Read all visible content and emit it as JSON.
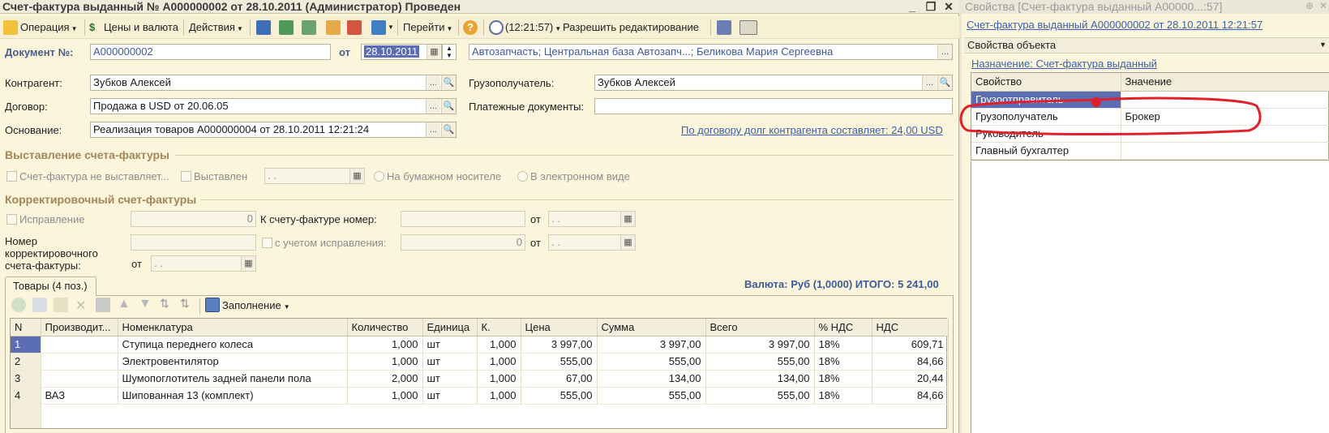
{
  "window": {
    "title": "Счет-фактура выданный № А000000002 от 28.10.2011 (Администратор) Проведен",
    "controls": [
      "_",
      "❐",
      "✕"
    ]
  },
  "toolbar": {
    "operation": "Операция",
    "prices": "Цены и валюта",
    "actions": "Действия",
    "goto": "Перейти",
    "time": "(12:21:57)",
    "allow_edit": "Разрешить редактирование"
  },
  "header": {
    "doc_label": "Документ №:",
    "doc_number": "А000000002",
    "date_label": "от",
    "date_value": "28.10.2011",
    "org_info": "Автозапчасть; Центральная база Автозапч...; Беликова Мария Сергеевна"
  },
  "form": {
    "counterparty_label": "Контрагент:",
    "counterparty_value": "Зубков Алексей",
    "contract_label": "Договор:",
    "contract_value": "Продажа в USD от 20.06.05",
    "basis_label": "Основание:",
    "basis_value": "Реализация товаров А000000004 от 28.10.2011 12:21:24",
    "consignee_label": "Грузополучатель:",
    "consignee_value": "Зубков Алексей",
    "payment_docs_label": "Платежные документы:",
    "payment_docs_value": "",
    "debt_link": "По договору долг контрагента составляет: 24,00 USD"
  },
  "issue_section": {
    "title": "Выставление счета-фактуры",
    "not_issued": "Счет-фактура не выставляет...",
    "issued": "Выставлен",
    "issued_date": " .  .",
    "paper": "На бумажном носителе",
    "electronic": "В электронном виде"
  },
  "correction_section": {
    "title": "Корректировочный счет-фактуры",
    "fix": "Исправление",
    "fix_number": "0",
    "to_invoice_label": "К счету-фактуре номер:",
    "to_invoice_value": "",
    "ot1": "от",
    "date1": " .  .",
    "corr_number_label": "Номер корректировочного счета-фактуры:",
    "corr_number_value": "",
    "with_fix": "с учетом исправления:",
    "with_fix_value": "0",
    "ot2": "от",
    "date2": " .  .",
    "ot3": "от",
    "date3": " .  ."
  },
  "goods": {
    "tab_label": "Товары (4 поз.)",
    "currency_total": "Валюта: Руб (1,0000) ИТОГО: 5 241,00",
    "fill_label": "Заполнение",
    "columns": [
      "N",
      "Производит...",
      "Номенклатура",
      "Количество",
      "Единица",
      "К.",
      "Цена",
      "Сумма",
      "Всего",
      "% НДС",
      "НДС"
    ],
    "rows": [
      [
        "1",
        "",
        "Ступица переднего колеса",
        "1,000",
        "шт",
        "1,000",
        "3 997,00",
        "3 997,00",
        "3 997,00",
        "18%",
        "609,71"
      ],
      [
        "2",
        "",
        "Электровентилятор",
        "1,000",
        "шт",
        "1,000",
        "555,00",
        "555,00",
        "555,00",
        "18%",
        "84,66"
      ],
      [
        "3",
        "",
        "Шумопоглотитель задней панели пола",
        "2,000",
        "шт",
        "1,000",
        "67,00",
        "134,00",
        "134,00",
        "18%",
        "20,44"
      ],
      [
        "4",
        "ВАЗ",
        "Шипованная 13 (комплект)",
        "1,000",
        "шт",
        "1,000",
        "555,00",
        "555,00",
        "555,00",
        "18%",
        "84,66"
      ]
    ]
  },
  "props_panel": {
    "title": "Свойства [Счет-фактура выданный А00000...:57]",
    "object_link": "Счет-фактура выданный А000000002 от 28.10.2011 12:21:57",
    "object_props": "Свойства объекта",
    "purpose_link": "Назначение: Счет-фактура выданный",
    "columns": [
      "Свойство",
      "Значение"
    ],
    "rows": [
      [
        "Грузоотправитель",
        ""
      ],
      [
        "Грузополучатель",
        "Брокер"
      ],
      [
        "Руководитель",
        ""
      ],
      [
        "Главный бухгалтер",
        ""
      ]
    ],
    "highlight_color": "#e0202a"
  }
}
